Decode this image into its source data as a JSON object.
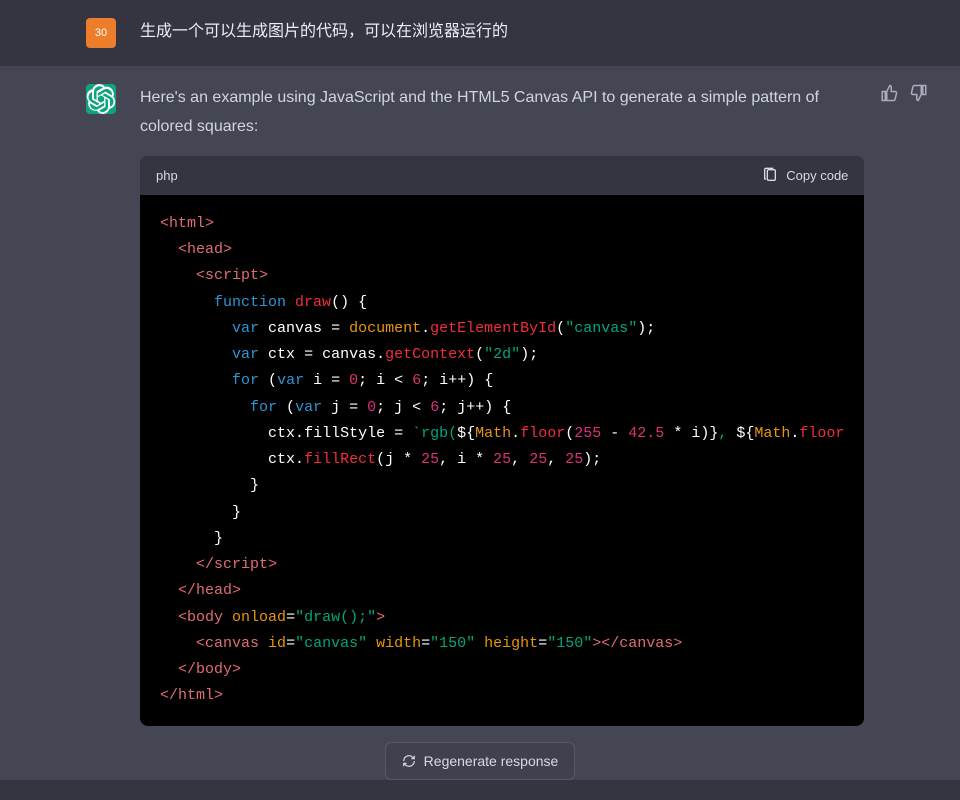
{
  "user": {
    "avatar_text": "30",
    "message": "生成一个可以生成图片的代码，可以在浏览器运行的"
  },
  "assistant": {
    "intro": "Here's an example using JavaScript and the HTML5 Canvas API to generate a simple pattern of colored squares:"
  },
  "codebar": {
    "lang": "php",
    "copy_label": "Copy code"
  },
  "code": {
    "fn_draw": "draw",
    "var_canvas": "canvas",
    "var_ctx": "ctx",
    "m_getel": "getElementById",
    "m_getctx": "getContext",
    "m_floor": "floor",
    "m_fillrect": "fillRect",
    "p_fillstyle": "fillStyle",
    "s_canvas": "\"canvas\"",
    "s_2d": "\"2d\"",
    "s_rgb": "`rgb(",
    "n0": "0",
    "n6": "6",
    "n25": "25",
    "n42_5": "42.5",
    "n255": "255",
    "n150a": "\"150\"",
    "n150b": "\"150\"",
    "a_onload": "\"draw();\"",
    "var_i": "i",
    "var_j": "j",
    "obj_document": "document",
    "obj_math1": "Math",
    "obj_math2": "Math"
  },
  "regen": {
    "label": "Regenerate response"
  }
}
